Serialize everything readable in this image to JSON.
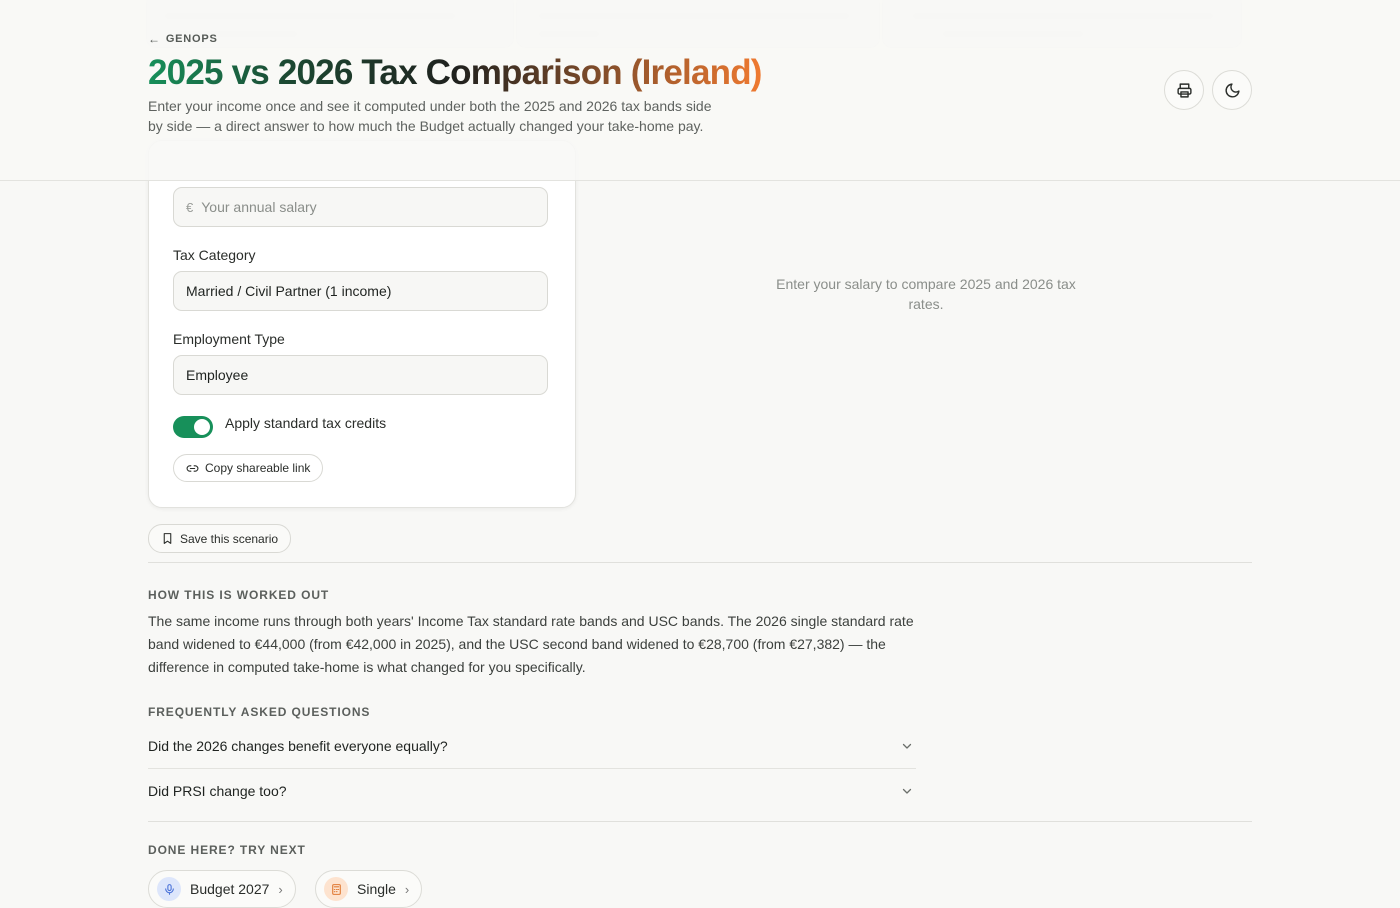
{
  "header": {
    "back_link": "GENOPS",
    "title": "2025 vs 2026 Tax Comparison (Ireland)",
    "subtitle": "Enter your income once and see it computed under both the 2025 and 2026 tax bands side by side — a direct answer to how much the Budget actually changed your take-home pay.",
    "actions": [
      {
        "icon": "printer-icon"
      },
      {
        "icon": "moon-icon"
      }
    ]
  },
  "form": {
    "salary": {
      "currency_symbol": "€",
      "placeholder": "Your annual salary",
      "value": ""
    },
    "tax_category": {
      "label": "Tax Category",
      "value": "Married / Civil Partner (1 income)"
    },
    "employment_type": {
      "label": "Employment Type",
      "value": "Employee"
    },
    "tax_credits_toggle": {
      "label": "Apply standard tax credits",
      "enabled": true
    },
    "copy_link_label": "Copy shareable link"
  },
  "results": {
    "empty_message": "Enter your salary to compare 2025 and 2026 tax rates."
  },
  "save_scenario_label": "Save this scenario",
  "how_it_works": {
    "heading": "HOW THIS IS WORKED OUT",
    "text": "The same income runs through both years' Income Tax standard rate bands and USC bands. The 2026 single standard rate band widened to €44,000 (from €42,000 in 2025), and the USC second band widened to €28,700 (from €27,382) — the difference in computed take-home is what changed for you specifically."
  },
  "faq": {
    "heading": "FREQUENTLY ASKED QUESTIONS",
    "items": [
      {
        "question": "Did the 2026 changes benefit everyone equally?"
      },
      {
        "question": "Did PRSI change too?"
      }
    ]
  },
  "try_next": {
    "heading": "DONE HERE? TRY NEXT",
    "items": [
      {
        "label": "Budget 2027",
        "icon": "microphone-icon"
      },
      {
        "label": "Single",
        "icon": "calculator-icon"
      }
    ]
  },
  "colors": {
    "accent_green": "#17905a",
    "accent_orange": "#f07a30",
    "background": "#f8f8f6"
  }
}
